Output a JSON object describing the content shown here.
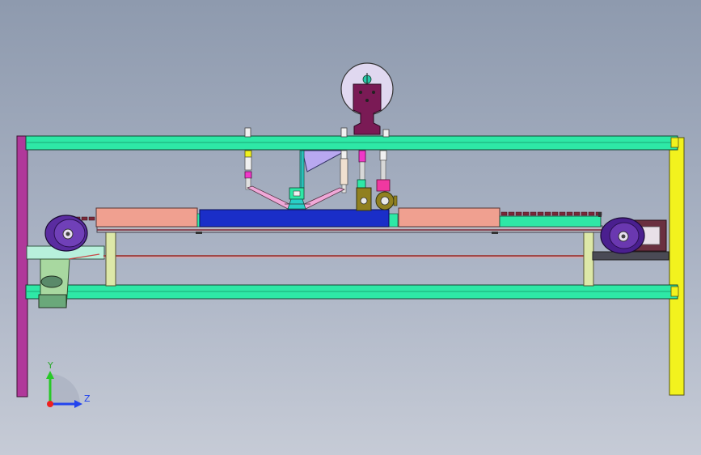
{
  "view": {
    "background_top": "#8e9aae",
    "background_bottom": "#c6cbd6"
  },
  "colors": {
    "frame_rail": "#2ee8a6",
    "left_post": "#b0389a",
    "right_post": "#f2f21e",
    "belt_block": "#f0a090",
    "main_plate": "#1a2ec8",
    "pulley": "#4a1f8f",
    "motor_housing": "#6a1c5a",
    "wedge": "#b8a8f0",
    "axis_y": "#28c828",
    "axis_z": "#2244ee",
    "axis_origin": "#ee2020"
  },
  "triad": {
    "y_label": "Y",
    "z_label": "Z"
  },
  "icons": {
    "coordinate_triad": "coordinate-triad-icon"
  }
}
